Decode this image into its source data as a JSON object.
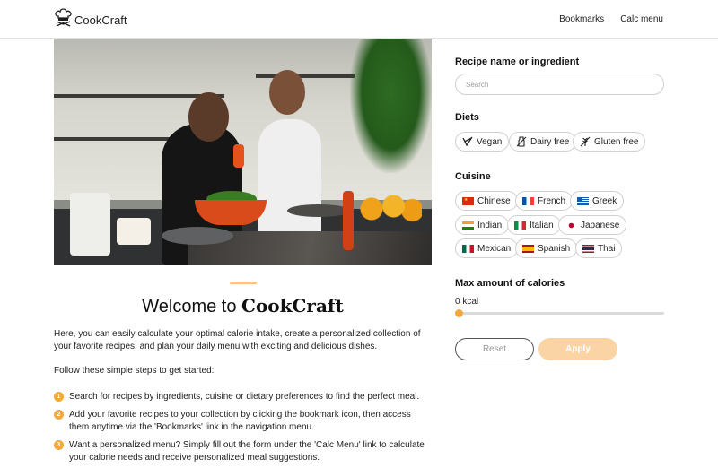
{
  "header": {
    "brand": "CookCraft",
    "nav": {
      "bookmarks": "Bookmarks",
      "calc_menu": "Calc menu"
    }
  },
  "welcome": {
    "title_prefix": "Welcome to",
    "title_brand": "CookCraft",
    "intro": "Here, you can easily calculate your optimal calorie intake, create a personalized collection of your favorite recipes, and plan your daily menu with exciting and delicious dishes.",
    "follow": "Follow these simple steps to get started:",
    "steps": [
      {
        "num": "1",
        "text": "Search for recipes by ingredients, cuisine or dietary preferences to find the perfect meal."
      },
      {
        "num": "2",
        "text": "Add your favorite recipes to your collection by clicking the bookmark icon, then access them anytime via the 'Bookmarks' link in the navigation menu."
      },
      {
        "num": "3",
        "text": "Want a personalized menu? Simply fill out the form under the 'Calc Menu' link to calculate your calorie needs and receive personalized meal suggestions."
      }
    ]
  },
  "filters": {
    "search": {
      "label": "Recipe name or ingredient",
      "placeholder": "Search",
      "value": ""
    },
    "diets": {
      "label": "Diets",
      "items": [
        {
          "label": "Vegan",
          "icon": "leaf-icon"
        },
        {
          "label": "Dairy free",
          "icon": "dairy-free-icon"
        },
        {
          "label": "Gluten free",
          "icon": "gluten-free-icon"
        }
      ]
    },
    "cuisine": {
      "label": "Cuisine",
      "items": [
        {
          "label": "Chinese",
          "flag": "china-flag-icon"
        },
        {
          "label": "French",
          "flag": "france-flag-icon"
        },
        {
          "label": "Greek",
          "flag": "greece-flag-icon"
        },
        {
          "label": "Indian",
          "flag": "india-flag-icon"
        },
        {
          "label": "Italian",
          "flag": "italy-flag-icon"
        },
        {
          "label": "Japanese",
          "flag": "japan-flag-icon"
        },
        {
          "label": "Mexican",
          "flag": "mexico-flag-icon"
        },
        {
          "label": "Spanish",
          "flag": "spain-flag-icon"
        },
        {
          "label": "Thai",
          "flag": "thailand-flag-icon"
        }
      ]
    },
    "calories": {
      "label": "Max amount of calories",
      "value_text": "0 kcal",
      "value_fraction": 0
    },
    "buttons": {
      "reset": "Reset",
      "apply": "Apply"
    }
  },
  "colors": {
    "accent": "#f4a83c",
    "accent_light": "#fbd4a6",
    "text": "#1e1e1e",
    "border": "#cfcfcf"
  }
}
